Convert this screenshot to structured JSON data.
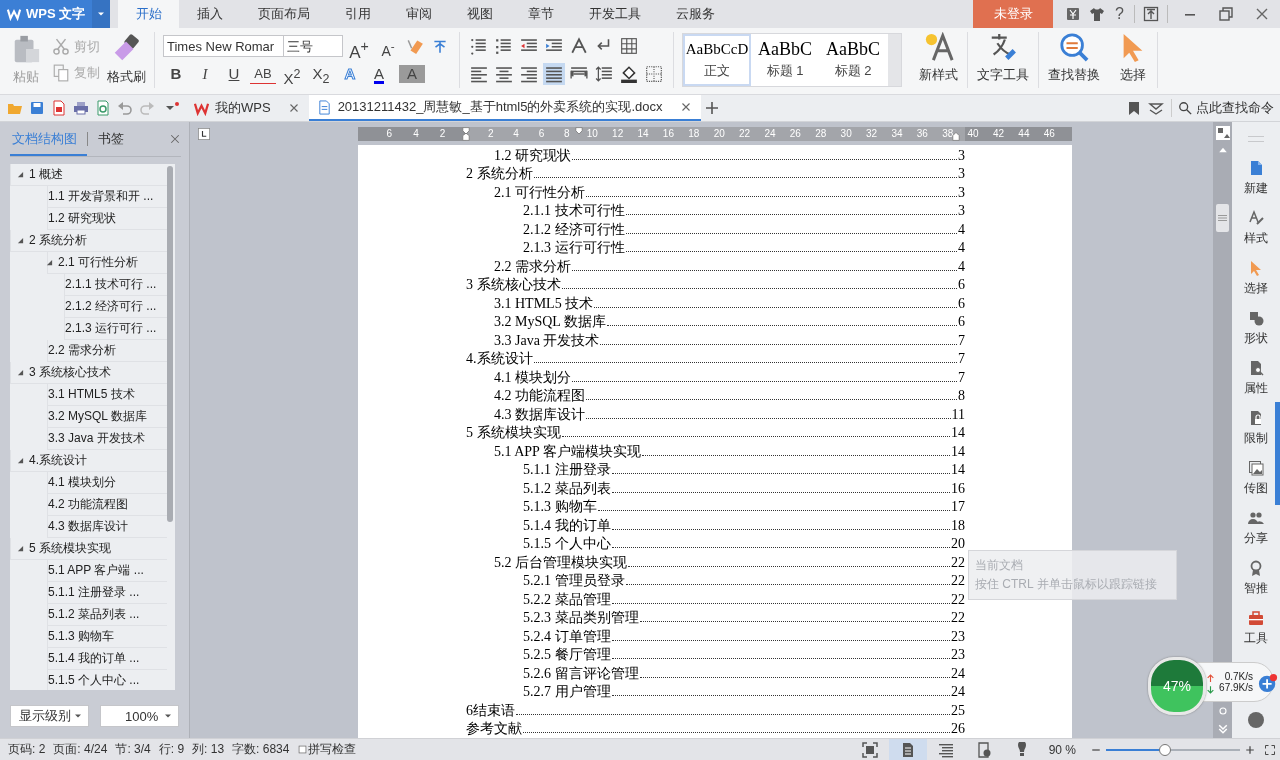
{
  "app_button": {
    "label": "WPS 文字"
  },
  "menu_tabs": [
    {
      "label": "开始",
      "selected": true
    },
    {
      "label": "插入",
      "selected": false
    },
    {
      "label": "页面布局",
      "selected": false
    },
    {
      "label": "引用",
      "selected": false
    },
    {
      "label": "审阅",
      "selected": false
    },
    {
      "label": "视图",
      "selected": false
    },
    {
      "label": "章节",
      "selected": false
    },
    {
      "label": "开发工具",
      "selected": false
    },
    {
      "label": "云服务",
      "selected": false
    }
  ],
  "login_button": "未登录",
  "help_label": "?",
  "ribbon": {
    "clipboard": [
      {
        "kind": "paste",
        "label": "粘贴",
        "disabled": true
      },
      {
        "kind": "cut",
        "label": "剪切",
        "disabled": true
      },
      {
        "kind": "copy",
        "label": "复制",
        "disabled": true
      },
      {
        "kind": "painter",
        "label": "格式刷",
        "disabled": false
      }
    ],
    "font": {
      "name": "Times New Romar",
      "size": "三号"
    },
    "size_buttons": [
      {
        "kind": "grow",
        "label": "A$^{+}$"
      },
      {
        "kind": "shrink",
        "label": "A$^{-}$"
      }
    ],
    "format_buttons": [
      {
        "kind": "bold",
        "label": "B"
      },
      {
        "kind": "italic",
        "label": "I"
      },
      {
        "kind": "underline",
        "label": "U"
      },
      {
        "kind": "strike",
        "label": "AB"
      },
      {
        "kind": "sup",
        "label": "X$^{2}$"
      },
      {
        "kind": "sub",
        "label": "X$_{2}$"
      },
      {
        "kind": "effect",
        "label": "A"
      },
      {
        "kind": "color",
        "label": "A"
      },
      {
        "kind": "shade",
        "label": "A"
      }
    ],
    "alignment": [
      {
        "kind": "left",
        "selected": false
      },
      {
        "kind": "center",
        "selected": false
      },
      {
        "kind": "right",
        "selected": false
      },
      {
        "kind": "justify",
        "selected": true
      },
      {
        "kind": "distributed",
        "selected": false
      }
    ],
    "styles": [
      {
        "preview": "AaBbCcD",
        "label": "正文",
        "selected": true
      },
      {
        "preview": "AaBbC",
        "label": "标题 1",
        "selected": false
      },
      {
        "preview": "AaBbC",
        "label": "标题 2",
        "selected": false
      }
    ],
    "tools": [
      {
        "kind": "new-style",
        "label": "新样式"
      },
      {
        "kind": "text-tools",
        "label": "文字工具"
      },
      {
        "kind": "find",
        "label": "查找替换"
      },
      {
        "kind": "select",
        "label": "选择"
      }
    ]
  },
  "doc_tabs": [
    {
      "label": "我的WPS",
      "selected": false
    },
    {
      "label": "20131211432_周慧敏_基于html5的外卖系统的实现.docx",
      "selected": true
    }
  ],
  "command_search": "点此查找命令",
  "sidebar": {
    "tabs": [
      {
        "label": "文档结构图",
        "selected": true
      },
      {
        "label": "书签",
        "selected": false
      }
    ],
    "tree": [
      {
        "label": "1 概述",
        "expanded": true,
        "children": [
          {
            "label": "1.1 开发背景和开 ..."
          },
          {
            "label": "1.2 研究现状"
          }
        ]
      },
      {
        "label": "2 系统分析",
        "expanded": true,
        "children": [
          {
            "label": "2.1 可行性分析",
            "expanded": true,
            "children": [
              {
                "label": "2.1.1 技术可行 ..."
              },
              {
                "label": "2.1.2 经济可行 ..."
              },
              {
                "label": "2.1.3 运行可行 ..."
              }
            ]
          },
          {
            "label": "2.2 需求分析"
          }
        ]
      },
      {
        "label": "3 系统核心技术",
        "expanded": true,
        "children": [
          {
            "label": "3.1 HTML5 技术"
          },
          {
            "label": "3.2 MySQL 数据库"
          },
          {
            "label": "3.3 Java 开发技术"
          }
        ]
      },
      {
        "label": "4.系统设计",
        "expanded": true,
        "children": [
          {
            "label": "4.1 模块划分"
          },
          {
            "label": "4.2 功能流程图"
          },
          {
            "label": "4.3 数据库设计"
          }
        ]
      },
      {
        "label": "5 系统模块实现",
        "expanded": true,
        "children": [
          {
            "label": "5.1 APP 客户端 ..."
          },
          {
            "label": "5.1.1 注册登录 ..."
          },
          {
            "label": "5.1.2 菜品列表 ..."
          },
          {
            "label": "5.1.3 购物车"
          },
          {
            "label": "5.1.4 我的订单 ..."
          },
          {
            "label": "5.1.5 个人中心 ..."
          }
        ]
      }
    ],
    "level_select": "显示级别",
    "zoom_select": "100%"
  },
  "ruler": {
    "left_labels": [
      "6",
      "4",
      "2"
    ],
    "labels": [
      "2",
      "4",
      "6",
      "8",
      "10",
      "12",
      "14",
      "16",
      "18",
      "20",
      "22",
      "24",
      "26",
      "28",
      "30",
      "32",
      "34",
      "36",
      "38",
      "40",
      "42",
      "44",
      "46"
    ]
  },
  "toc": [
    {
      "kind": "toc2",
      "label": "1.2  研究现状",
      "page": "3"
    },
    {
      "kind": "toc1",
      "label": "2  系统分析",
      "page": "3"
    },
    {
      "kind": "toc2",
      "label": "2.1  可行性分析",
      "page": "3"
    },
    {
      "kind": "toc3",
      "label": "2.1.1 技术可行性",
      "page": "3"
    },
    {
      "kind": "toc3",
      "label": "2.1.2 经济可行性",
      "page": "4"
    },
    {
      "kind": "toc3",
      "label": "2.1.3 运行可行性",
      "page": "4"
    },
    {
      "kind": "toc2",
      "label": "2.2  需求分析",
      "page": "4"
    },
    {
      "kind": "toc1",
      "label": "3  系统核心技术",
      "page": "6"
    },
    {
      "kind": "toc2",
      "label": "3.1 HTML5 技术",
      "page": "6"
    },
    {
      "kind": "toc2",
      "label": "3.2 MySQL 数据库",
      "page": "6"
    },
    {
      "kind": "toc2",
      "label": "3.3 Java 开发技术",
      "page": "7"
    },
    {
      "kind": "toc1",
      "label": "4.系统设计",
      "page": "7"
    },
    {
      "kind": "toc2",
      "label": "4.1  模块划分",
      "page": "7"
    },
    {
      "kind": "toc2",
      "label": "4.2  功能流程图",
      "page": "8"
    },
    {
      "kind": "toc2",
      "label": "4.3  数据库设计",
      "page": "11"
    },
    {
      "kind": "toc1",
      "label": "5  系统模块实现",
      "page": "14"
    },
    {
      "kind": "toc2",
      "label": "5.1 APP 客户端模块实现",
      "page": "14"
    },
    {
      "kind": "toc3",
      "label": "5.1.1  注册登录",
      "page": "14"
    },
    {
      "kind": "toc3",
      "label": "5.1.2  菜品列表",
      "page": "16"
    },
    {
      "kind": "toc3",
      "label": "5.1.3  购物车",
      "page": "17"
    },
    {
      "kind": "toc3",
      "label": "5.1.4  我的订单",
      "page": "18"
    },
    {
      "kind": "toc3",
      "label": "5.1.5  个人中心",
      "page": "20"
    },
    {
      "kind": "toc2",
      "label": "5.2  后台管理模块实现",
      "page": "22"
    },
    {
      "kind": "toc3",
      "label": "5.2.1  管理员登录",
      "page": "22"
    },
    {
      "kind": "toc3",
      "label": "5.2.2  菜品管理",
      "page": "22"
    },
    {
      "kind": "toc3",
      "label": "5.2.3  菜品类别管理",
      "page": "22"
    },
    {
      "kind": "toc3",
      "label": "5.2.4  订单管理",
      "page": "23"
    },
    {
      "kind": "toc3",
      "label": "5.2.5  餐厅管理",
      "page": "23"
    },
    {
      "kind": "toc3",
      "label": "5.2.6  留言评论管理",
      "page": "24"
    },
    {
      "kind": "toc3",
      "label": "5.2.7  用户管理",
      "page": "24"
    },
    {
      "kind": "toc1",
      "label": "6结束语",
      "page": "25"
    },
    {
      "kind": "toc1",
      "label": "参考文献",
      "page": "26"
    }
  ],
  "tooltip": {
    "title": "当前文档",
    "hint": "按住 CTRL 并单击鼠标以跟踪链接"
  },
  "side_tools": [
    {
      "kind": "new",
      "label": "新建"
    },
    {
      "kind": "style",
      "label": "样式"
    },
    {
      "kind": "select",
      "label": "选择"
    },
    {
      "kind": "shape",
      "label": "形状"
    },
    {
      "kind": "props",
      "label": "属性"
    },
    {
      "kind": "restrict",
      "label": "限制"
    },
    {
      "kind": "picture",
      "label": "传图"
    },
    {
      "kind": "share",
      "label": "分享"
    },
    {
      "kind": "recommend",
      "label": "智推"
    },
    {
      "kind": "tools",
      "label": "工具"
    }
  ],
  "net_monitor": {
    "percent": "47%",
    "up": "0.7K/s",
    "down": "67.9K/s"
  },
  "status": {
    "items": [
      "页码: 2",
      "页面: 4/24",
      "节: 3/4",
      "行: 9",
      "列: 13",
      "字数: 6834"
    ],
    "spell_check": {
      "label": "拼写检查",
      "checked": false
    },
    "views": [
      {
        "kind": "fullscreen",
        "selected": false
      },
      {
        "kind": "page",
        "selected": true
      },
      {
        "kind": "outline",
        "selected": false
      },
      {
        "kind": "web",
        "selected": false
      },
      {
        "kind": "reading",
        "selected": false
      }
    ],
    "zoom": "90 %",
    "zoom_slider": {
      "level": 0.44
    }
  }
}
